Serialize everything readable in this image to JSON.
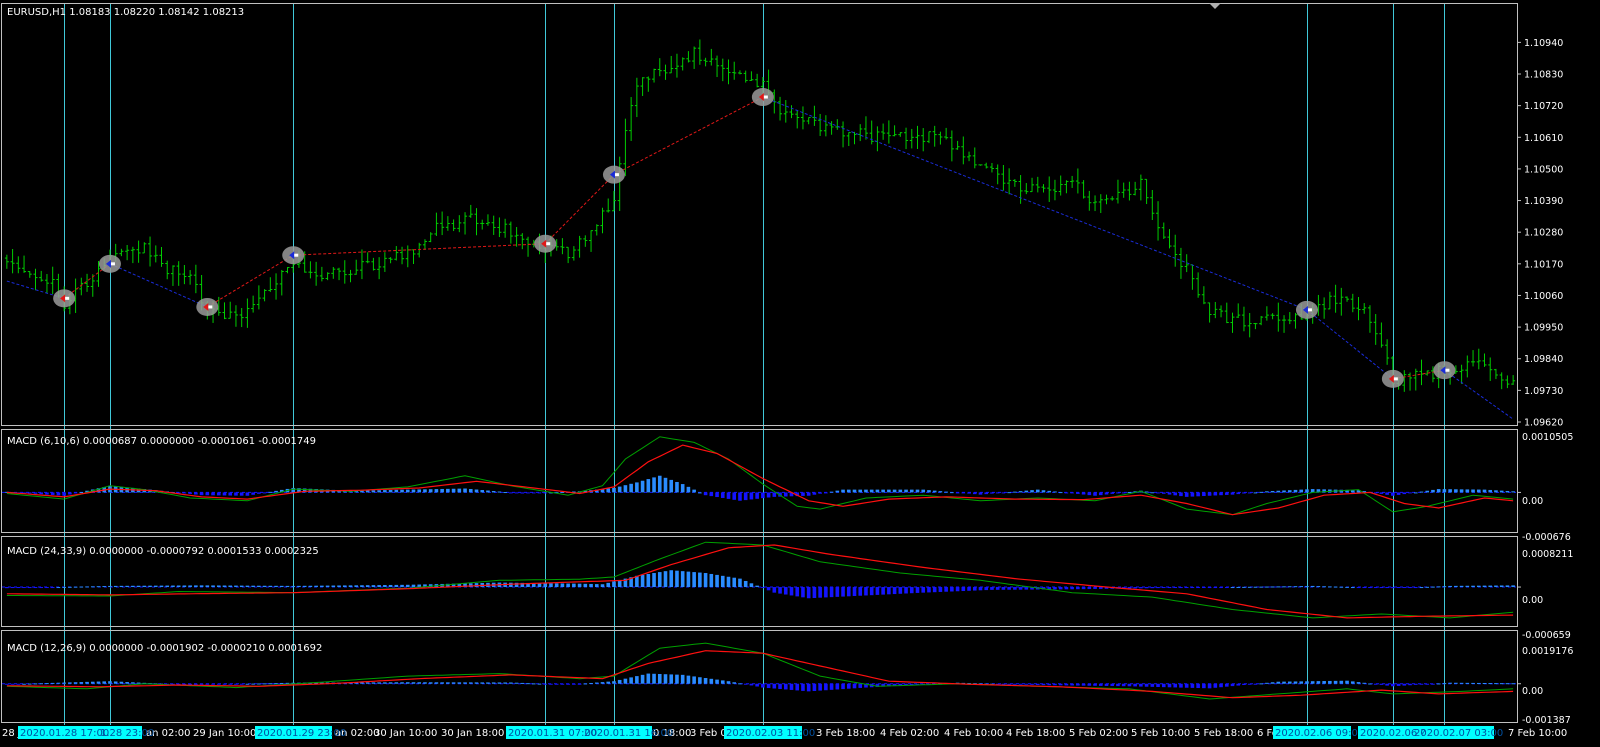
{
  "colors": {
    "background": "#000000",
    "frame": "#c0c0c0",
    "text": "#ffffff",
    "candle": "#00cc00",
    "cyan_line": "#40c8d8",
    "macd_main": "#00a000",
    "macd_signal": "#ff1010",
    "hist_pos": "#2a8cff",
    "hist_neg": "#1414ff",
    "zigzag_up": "#e01818",
    "zigzag_down": "#1a2cd8",
    "marker_fill": "#9a9a9a",
    "time_tag_bg": "#00ffff",
    "time_tag_text": "#0050a0"
  },
  "price_panel": {
    "header": "EURUSD,H1  1.08183 1.08220 1.08142 1.08213",
    "price_labels": [
      "1.10940",
      "1.10830",
      "1.10720",
      "1.10610",
      "1.10500",
      "1.10390",
      "1.10280",
      "1.10170",
      "1.10060",
      "1.09950",
      "1.09840",
      "1.09730",
      "1.09620"
    ]
  },
  "macd_panels": [
    {
      "header": "MACD  (6,10,6) 0.0000687 0.0000000 -0.0001061 -0.0001749",
      "labels": [
        "0.0010505",
        "0.00",
        "-0.000676"
      ]
    },
    {
      "header": "MACD  (24,33,9) 0.0000000 -0.0000792 0.0001533 0.0002325",
      "labels": [
        "0.0008211",
        "0.00",
        "-0.000659"
      ]
    },
    {
      "header": "MACD  (12,26,9) 0.0000000 -0.0001902 -0.0000210 0.0001692",
      "labels": [
        "0.0019176",
        "0.00",
        "-0.001387"
      ]
    }
  ],
  "time_axis": {
    "labels": [
      "28 J",
      "an 02:00",
      "29 Jan 10:00",
      "an 02:00",
      "30 Jan 10:00",
      "30 Jan 18:00",
      "0 18:00",
      "3 Feb 0",
      "3 Feb 18:00",
      "4 Feb 02:00",
      "4 Feb 10:00",
      "4 Feb 18:00",
      "5 Feb 02:00",
      "5 Feb 10:00",
      "5 Feb 18:00",
      "6 Fe",
      "7 Feb 10:00"
    ],
    "tags": [
      "2020.01.28 17:00",
      "1.28 23:00",
      "2020.01.29 23:00",
      "2020.01.31 07:00",
      "2020.01.31 16:00",
      "2020.02.03 11:00",
      "2020.02.06 09:00",
      "2020.02.06 ?",
      "2020.02.07 03:00"
    ]
  },
  "chart_data": [
    {
      "type": "candlestick",
      "symbol": "EURUSD",
      "timeframe": "H1",
      "ylim": [
        1.0962,
        1.1099
      ],
      "zigzag_pivots": [
        {
          "bar": 0,
          "price": 1.1011,
          "kind": "start"
        },
        {
          "bar": 10,
          "price": 1.1005,
          "kind": "low",
          "marker": "sell"
        },
        {
          "bar": 18,
          "price": 1.1017,
          "kind": "high",
          "marker": "buy"
        },
        {
          "bar": 35,
          "price": 1.1002,
          "kind": "low",
          "marker": "sell"
        },
        {
          "bar": 50,
          "price": 1.102,
          "kind": "high",
          "marker": "buy"
        },
        {
          "bar": 94,
          "price": 1.1024,
          "kind": "low",
          "marker": "sell"
        },
        {
          "bar": 106,
          "price": 1.1048,
          "kind": "mid",
          "marker": "buy"
        },
        {
          "bar": 132,
          "price": 1.1075,
          "kind": "high",
          "marker": "sell"
        },
        {
          "bar": 227,
          "price": 1.1001,
          "kind": "low",
          "marker": "buy"
        },
        {
          "bar": 242,
          "price": 1.0977,
          "kind": "low",
          "marker": "sell"
        },
        {
          "bar": 251,
          "price": 1.098,
          "kind": "high",
          "marker": "buy"
        },
        {
          "bar": 263,
          "price": 1.0963,
          "kind": "end"
        }
      ],
      "price_path": [
        [
          0,
          1.1019
        ],
        [
          8,
          1.101
        ],
        [
          10,
          1.1003
        ],
        [
          14,
          1.101
        ],
        [
          18,
          1.102
        ],
        [
          24,
          1.1022
        ],
        [
          28,
          1.1015
        ],
        [
          32,
          1.1013
        ],
        [
          35,
          1.1
        ],
        [
          40,
          1.0998
        ],
        [
          44,
          1.1005
        ],
        [
          50,
          1.1018
        ],
        [
          55,
          1.1013
        ],
        [
          62,
          1.1016
        ],
        [
          70,
          1.102
        ],
        [
          75,
          1.103
        ],
        [
          82,
          1.1033
        ],
        [
          88,
          1.1028
        ],
        [
          94,
          1.1023
        ],
        [
          98,
          1.1021
        ],
        [
          102,
          1.1028
        ],
        [
          106,
          1.104
        ],
        [
          108,
          1.1065
        ],
        [
          110,
          1.108
        ],
        [
          116,
          1.1086
        ],
        [
          120,
          1.109
        ],
        [
          126,
          1.1083
        ],
        [
          132,
          1.108
        ],
        [
          136,
          1.1068
        ],
        [
          140,
          1.1066
        ],
        [
          146,
          1.1063
        ],
        [
          152,
          1.1061
        ],
        [
          158,
          1.1062
        ],
        [
          164,
          1.106
        ],
        [
          170,
          1.105
        ],
        [
          176,
          1.1045
        ],
        [
          180,
          1.1042
        ],
        [
          186,
          1.1045
        ],
        [
          190,
          1.1038
        ],
        [
          196,
          1.1042
        ],
        [
          198,
          1.1045
        ],
        [
          202,
          1.1025
        ],
        [
          206,
          1.1015
        ],
        [
          210,
          1.1
        ],
        [
          216,
          1.0997
        ],
        [
          222,
          1.0998
        ],
        [
          228,
          1.1
        ],
        [
          232,
          1.1005
        ],
        [
          236,
          1.1003
        ],
        [
          240,
          1.099
        ],
        [
          242,
          1.0976
        ],
        [
          246,
          1.0978
        ],
        [
          251,
          1.098
        ],
        [
          257,
          1.0982
        ],
        [
          263,
          1.0975
        ]
      ],
      "vertical_marker_bars": [
        10,
        18,
        50,
        94,
        106,
        132,
        227,
        242,
        251
      ]
    },
    {
      "type": "macd",
      "params": [
        6,
        10,
        6
      ],
      "ylim": [
        -0.000676,
        0.0010505
      ],
      "main_curve": [
        [
          0,
          -2e-05
        ],
        [
          10,
          -0.00012
        ],
        [
          18,
          0.00012
        ],
        [
          24,
          5e-05
        ],
        [
          32,
          -0.0001
        ],
        [
          42,
          -0.00015
        ],
        [
          50,
          6e-05
        ],
        [
          60,
          2e-05
        ],
        [
          70,
          0.0001
        ],
        [
          80,
          0.0003
        ],
        [
          88,
          0.00012
        ],
        [
          98,
          -5e-05
        ],
        [
          104,
          0.00012
        ],
        [
          108,
          0.0006
        ],
        [
          114,
          0.001
        ],
        [
          120,
          0.0009
        ],
        [
          126,
          0.0006
        ],
        [
          132,
          0.00015
        ],
        [
          138,
          -0.00025
        ],
        [
          142,
          -0.0003
        ],
        [
          150,
          -0.0001
        ],
        [
          160,
          -5e-05
        ],
        [
          170,
          -0.00015
        ],
        [
          180,
          -0.0001
        ],
        [
          190,
          -0.00015
        ],
        [
          198,
          2e-05
        ],
        [
          206,
          -0.0003
        ],
        [
          214,
          -0.0004
        ],
        [
          220,
          -0.0002
        ],
        [
          228,
          0.0
        ],
        [
          236,
          5e-05
        ],
        [
          242,
          -0.00035
        ],
        [
          248,
          -0.00025
        ],
        [
          256,
          -5e-05
        ],
        [
          263,
          -0.00012
        ]
      ],
      "signal_curve": [
        [
          0,
          0.0
        ],
        [
          10,
          -8e-05
        ],
        [
          18,
          6e-05
        ],
        [
          26,
          3e-05
        ],
        [
          34,
          -8e-05
        ],
        [
          42,
          -0.00012
        ],
        [
          52,
          2e-05
        ],
        [
          62,
          4e-05
        ],
        [
          72,
          8e-05
        ],
        [
          82,
          0.0002
        ],
        [
          92,
          8e-05
        ],
        [
          100,
          -2e-05
        ],
        [
          106,
          0.0001
        ],
        [
          112,
          0.00055
        ],
        [
          118,
          0.00085
        ],
        [
          124,
          0.0007
        ],
        [
          132,
          0.00025
        ],
        [
          140,
          -0.00015
        ],
        [
          146,
          -0.00025
        ],
        [
          154,
          -0.00012
        ],
        [
          164,
          -8e-05
        ],
        [
          176,
          -0.00012
        ],
        [
          188,
          -0.00013
        ],
        [
          198,
          -5e-05
        ],
        [
          206,
          -0.0002
        ],
        [
          214,
          -0.0004
        ],
        [
          222,
          -0.00028
        ],
        [
          230,
          -5e-05
        ],
        [
          238,
          0.0
        ],
        [
          244,
          -0.0002
        ],
        [
          250,
          -0.00028
        ],
        [
          258,
          -0.0001
        ],
        [
          263,
          -0.00015
        ]
      ],
      "histogram": [
        [
          0,
          1e-05
        ],
        [
          10,
          -6e-05
        ],
        [
          18,
          0.00012
        ],
        [
          26,
          4e-05
        ],
        [
          34,
          -5e-05
        ],
        [
          42,
          -6e-05
        ],
        [
          50,
          8e-05
        ],
        [
          60,
          3e-05
        ],
        [
          70,
          5e-05
        ],
        [
          80,
          7e-05
        ],
        [
          90,
          -2e-05
        ],
        [
          100,
          2e-05
        ],
        [
          106,
          8e-05
        ],
        [
          110,
          0.00018
        ],
        [
          114,
          0.0003
        ],
        [
          118,
          0.00015
        ],
        [
          122,
          -5e-05
        ],
        [
          128,
          -0.00015
        ],
        [
          134,
          -8e-05
        ],
        [
          140,
          -6e-05
        ],
        [
          146,
          5e-05
        ],
        [
          160,
          5e-05
        ],
        [
          170,
          -4e-05
        ],
        [
          180,
          5e-05
        ],
        [
          190,
          -6e-05
        ],
        [
          198,
          3e-05
        ],
        [
          206,
          -8e-05
        ],
        [
          214,
          -4e-05
        ],
        [
          220,
          2e-05
        ],
        [
          228,
          6e-05
        ],
        [
          236,
          4e-05
        ],
        [
          242,
          -6e-05
        ],
        [
          250,
          6e-05
        ],
        [
          258,
          5e-05
        ],
        [
          263,
          2e-05
        ]
      ]
    },
    {
      "type": "macd",
      "params": [
        24,
        33,
        9
      ],
      "ylim": [
        -0.000659,
        0.0008211
      ],
      "main_curve": [
        [
          0,
          -0.00015
        ],
        [
          18,
          -0.00016
        ],
        [
          30,
          -8e-05
        ],
        [
          50,
          -0.0001
        ],
        [
          70,
          -2e-05
        ],
        [
          86,
          0.00012
        ],
        [
          100,
          0.00014
        ],
        [
          106,
          0.00018
        ],
        [
          114,
          0.0005
        ],
        [
          122,
          0.0008
        ],
        [
          132,
          0.00075
        ],
        [
          142,
          0.00045
        ],
        [
          156,
          0.00025
        ],
        [
          170,
          0.00012
        ],
        [
          186,
          -0.0001
        ],
        [
          200,
          -0.00018
        ],
        [
          214,
          -0.0004
        ],
        [
          228,
          -0.00055
        ],
        [
          240,
          -0.00048
        ],
        [
          252,
          -0.00055
        ],
        [
          263,
          -0.00045
        ]
      ],
      "signal_curve": [
        [
          0,
          -0.00012
        ],
        [
          18,
          -0.00014
        ],
        [
          32,
          -0.00012
        ],
        [
          50,
          -0.0001
        ],
        [
          70,
          -3e-05
        ],
        [
          88,
          5e-05
        ],
        [
          102,
          0.0001
        ],
        [
          108,
          0.00012
        ],
        [
          116,
          0.0004
        ],
        [
          126,
          0.0007
        ],
        [
          134,
          0.00075
        ],
        [
          144,
          0.00058
        ],
        [
          160,
          0.00035
        ],
        [
          176,
          0.00015
        ],
        [
          192,
          0.0
        ],
        [
          206,
          -0.00012
        ],
        [
          220,
          -0.0004
        ],
        [
          234,
          -0.00055
        ],
        [
          248,
          -0.00052
        ],
        [
          263,
          -0.0005
        ]
      ],
      "histogram": [
        [
          0,
          -2e-05
        ],
        [
          18,
          2e-05
        ],
        [
          34,
          3e-05
        ],
        [
          50,
          2e-05
        ],
        [
          70,
          4e-05
        ],
        [
          86,
          8e-05
        ],
        [
          100,
          6e-05
        ],
        [
          104,
          5e-05
        ],
        [
          110,
          0.0002
        ],
        [
          116,
          0.0003
        ],
        [
          122,
          0.00025
        ],
        [
          128,
          0.00015
        ],
        [
          134,
          -0.0001
        ],
        [
          140,
          -0.0002
        ],
        [
          150,
          -0.00015
        ],
        [
          160,
          -0.0001
        ],
        [
          172,
          -5e-05
        ],
        [
          186,
          -4e-05
        ],
        [
          200,
          -2e-05
        ],
        [
          214,
          0.0
        ],
        [
          228,
          2e-05
        ],
        [
          242,
          -2e-05
        ],
        [
          252,
          2e-05
        ],
        [
          263,
          3e-05
        ]
      ]
    },
    {
      "type": "macd",
      "params": [
        12,
        26,
        9
      ],
      "ylim": [
        -0.001387,
        0.0019176
      ],
      "main_curve": [
        [
          0,
          -0.0001
        ],
        [
          14,
          -0.0002
        ],
        [
          24,
          0.0
        ],
        [
          40,
          -0.00015
        ],
        [
          54,
          5e-05
        ],
        [
          70,
          0.0003
        ],
        [
          86,
          0.0004
        ],
        [
          100,
          0.0002
        ],
        [
          106,
          0.0003
        ],
        [
          114,
          0.0014
        ],
        [
          122,
          0.0016
        ],
        [
          132,
          0.0012
        ],
        [
          142,
          0.0003
        ],
        [
          152,
          -0.0001
        ],
        [
          166,
          0.0
        ],
        [
          180,
          -0.0001
        ],
        [
          196,
          -0.0002
        ],
        [
          210,
          -0.0006
        ],
        [
          222,
          -0.0004
        ],
        [
          234,
          -0.0002
        ],
        [
          242,
          -0.0004
        ],
        [
          254,
          -0.0003
        ],
        [
          263,
          -0.0002
        ]
      ],
      "signal_curve": [
        [
          0,
          -8e-05
        ],
        [
          16,
          -0.00012
        ],
        [
          30,
          -5e-05
        ],
        [
          44,
          -0.0001
        ],
        [
          58,
          2e-05
        ],
        [
          72,
          0.0002
        ],
        [
          88,
          0.00035
        ],
        [
          104,
          0.0002
        ],
        [
          112,
          0.0008
        ],
        [
          122,
          0.0013
        ],
        [
          132,
          0.0012
        ],
        [
          144,
          0.0006
        ],
        [
          154,
          0.0001
        ],
        [
          168,
          -2e-05
        ],
        [
          184,
          -0.00012
        ],
        [
          200,
          -0.0003
        ],
        [
          214,
          -0.00055
        ],
        [
          226,
          -0.00045
        ],
        [
          240,
          -0.00025
        ],
        [
          250,
          -0.0004
        ],
        [
          263,
          -0.0003
        ]
      ],
      "histogram": [
        [
          0,
          -2e-05
        ],
        [
          18,
          0.0001
        ],
        [
          32,
          -5e-05
        ],
        [
          50,
          4e-05
        ],
        [
          70,
          6e-05
        ],
        [
          88,
          5e-05
        ],
        [
          98,
          -4e-05
        ],
        [
          106,
          0.0001
        ],
        [
          112,
          0.0004
        ],
        [
          118,
          0.00035
        ],
        [
          126,
          0.0001
        ],
        [
          132,
          -0.00015
        ],
        [
          140,
          -0.0003
        ],
        [
          150,
          -0.00015
        ],
        [
          166,
          4e-05
        ],
        [
          180,
          -5e-05
        ],
        [
          196,
          -0.0001
        ],
        [
          210,
          -0.00018
        ],
        [
          222,
          8e-05
        ],
        [
          234,
          0.00012
        ],
        [
          242,
          -0.0001
        ],
        [
          252,
          4e-05
        ],
        [
          263,
          2e-05
        ]
      ]
    }
  ]
}
